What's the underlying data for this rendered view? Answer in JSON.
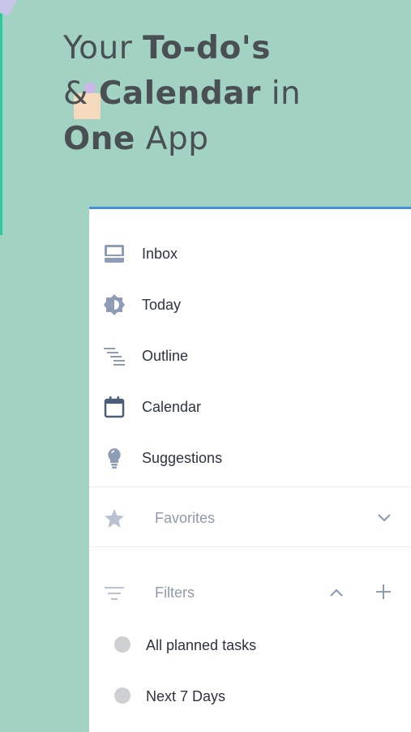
{
  "headline": {
    "line1_regular": "Your ",
    "line1_bold": "To-do's",
    "line2_regular_a": "& ",
    "line2_bold": "Calendar",
    "line2_regular_b": " in",
    "line3_bold": "One",
    "line3_regular": " App"
  },
  "nav": {
    "items": [
      {
        "label": "Inbox",
        "icon": "inbox-icon"
      },
      {
        "label": "Today",
        "icon": "today-icon"
      },
      {
        "label": "Outline",
        "icon": "outline-icon"
      },
      {
        "label": "Calendar",
        "icon": "calendar-icon"
      },
      {
        "label": "Suggestions",
        "icon": "lightbulb-icon"
      }
    ]
  },
  "favorites": {
    "label": "Favorites",
    "icon": "star-icon",
    "state": "collapsed"
  },
  "filters": {
    "label": "Filters",
    "icon": "filter-icon",
    "state": "expanded",
    "items": [
      {
        "label": "All planned tasks"
      },
      {
        "label": "Next 7 Days"
      }
    ]
  },
  "colors": {
    "background": "#a2d2c1",
    "panel_accent": "#4a90d9",
    "icon": "#8e9cb6",
    "text": "#2b3440",
    "muted_text": "#8f9aab"
  }
}
